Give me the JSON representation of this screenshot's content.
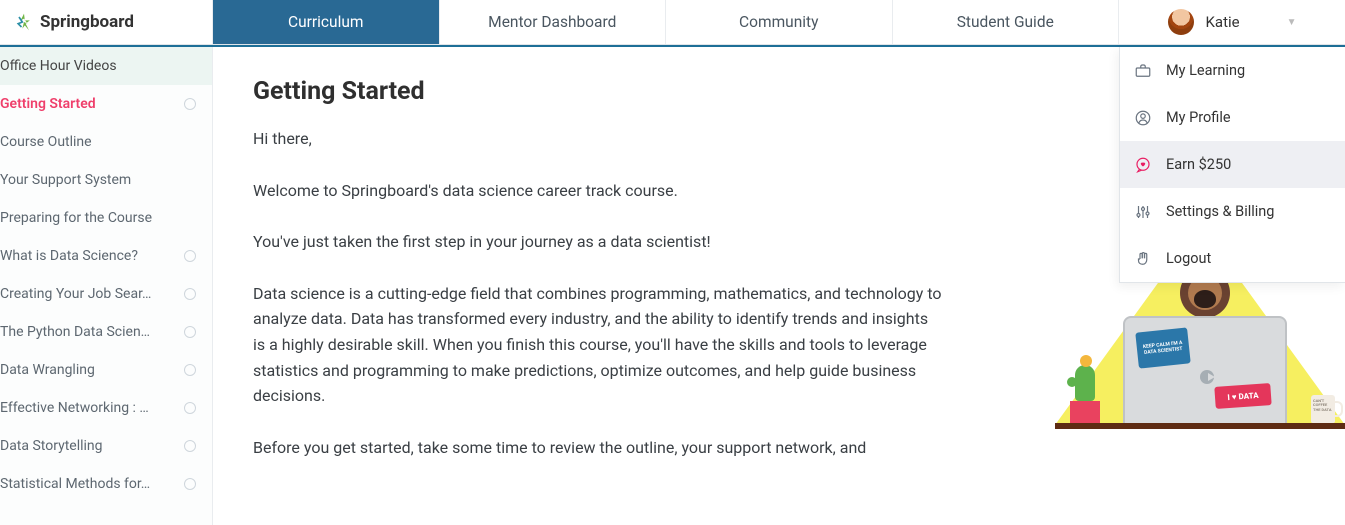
{
  "brand": "Springboard",
  "tabs": [
    "Curriculum",
    "Mentor Dashboard",
    "Community",
    "Student Guide"
  ],
  "user": {
    "name": "Katie"
  },
  "dropdown": [
    {
      "label": "My Learning",
      "icon": "briefcase-icon",
      "highlight": false
    },
    {
      "label": "My Profile",
      "icon": "user-icon",
      "highlight": false
    },
    {
      "label": "Earn $250",
      "icon": "heart-bubble-icon",
      "highlight": true
    },
    {
      "label": "Settings & Billing",
      "icon": "sliders-icon",
      "highlight": false
    },
    {
      "label": "Logout",
      "icon": "hand-icon",
      "highlight": false
    }
  ],
  "sidebar": [
    {
      "label": "Office Hour Videos",
      "type": "header"
    },
    {
      "label": "Getting Started",
      "type": "active"
    },
    {
      "label": "Course Outline",
      "type": "item-nocircle"
    },
    {
      "label": "Your Support System",
      "type": "item-nocircle"
    },
    {
      "label": "Preparing for the Course",
      "type": "item-nocircle"
    },
    {
      "label": "What is Data Science?",
      "type": "item"
    },
    {
      "label": "Creating Your Job Sear…",
      "type": "item"
    },
    {
      "label": "The Python Data Scien…",
      "type": "item"
    },
    {
      "label": "Data Wrangling",
      "type": "item"
    },
    {
      "label": "Effective Networking : …",
      "type": "item"
    },
    {
      "label": "Data Storytelling",
      "type": "item"
    },
    {
      "label": "Statistical Methods for…",
      "type": "item"
    }
  ],
  "page": {
    "title": "Getting Started",
    "p1": "Hi there,",
    "p2": "Welcome to Springboard's data science career track course.",
    "p3": "You've just taken the first step in your journey as a data scientist!",
    "p4": "Data science is a cutting-edge field that combines programming, mathematics, and technology to analyze data. Data has transformed every industry, and the ability to identify trends and insights is a highly desirable skill. When you finish this course, you'll have the skills and tools to leverage statistics and programming to make predictions, optimize outcomes, and help guide business decisions.",
    "p5": "Before you get started, take some time to review the outline, your support network, and"
  },
  "stickers": {
    "keepcalm": "KEEP CALM I'M A DATA SCIENTIST",
    "ilove": "I ♥ DATA",
    "mug": "CAN'T COFFEE THE DATA"
  }
}
